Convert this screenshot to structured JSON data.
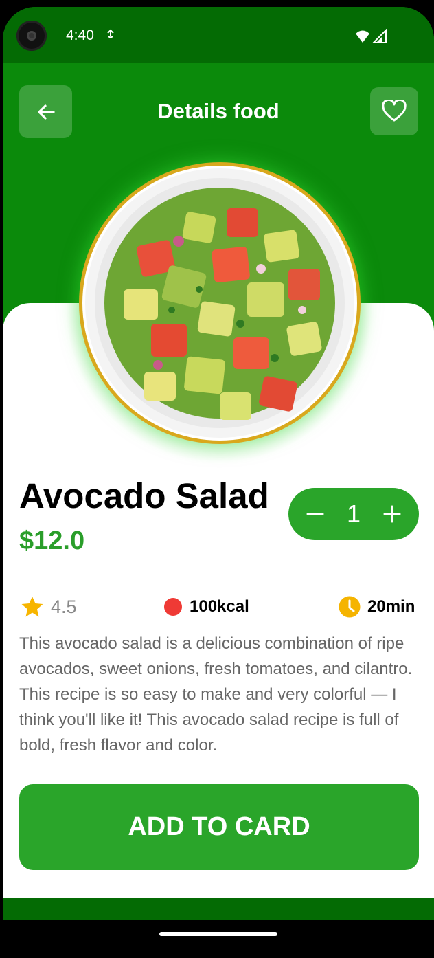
{
  "status_bar": {
    "time": "4:40"
  },
  "header": {
    "title": "Details food"
  },
  "food": {
    "name": "Avocado Salad",
    "price": "$12.0",
    "quantity": "1",
    "rating": "4.5",
    "calories": "100kcal",
    "duration": "20min",
    "description": "This avocado salad is a delicious combination of ripe avocados, sweet onions, fresh tomatoes, and cilantro. This recipe is so easy to make and very colorful — I think you'll like it! This avocado salad recipe is full of bold, fresh flavor and color."
  },
  "actions": {
    "add_label": "ADD TO CARD"
  },
  "icons": {
    "back": "arrow-left-icon",
    "favorite": "heart-outline-icon",
    "rating": "star-icon",
    "calories": "red-dot-icon",
    "duration": "clock-icon"
  },
  "colors": {
    "primary_green": "#2aa52a",
    "header_green": "#0b8a0b",
    "dark_green": "#046b04",
    "price_green": "#2a9e2a",
    "star_yellow": "#f7b500",
    "kcal_red": "#ef3a35",
    "clock_orange": "#f5b400"
  }
}
